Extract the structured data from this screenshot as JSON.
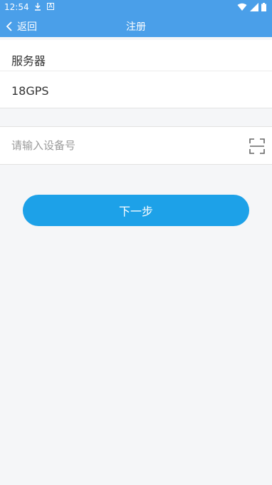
{
  "status_bar": {
    "time": "12:54"
  },
  "app_bar": {
    "back_label": "返回",
    "title": "注册"
  },
  "form": {
    "server_label": "服务器",
    "server_value": "18GPS",
    "device_placeholder": "请输入设备号",
    "device_value": ""
  },
  "next_button": {
    "label": "下一步"
  },
  "colors": {
    "header": "#4a9fe9",
    "button": "#1da1e8"
  }
}
